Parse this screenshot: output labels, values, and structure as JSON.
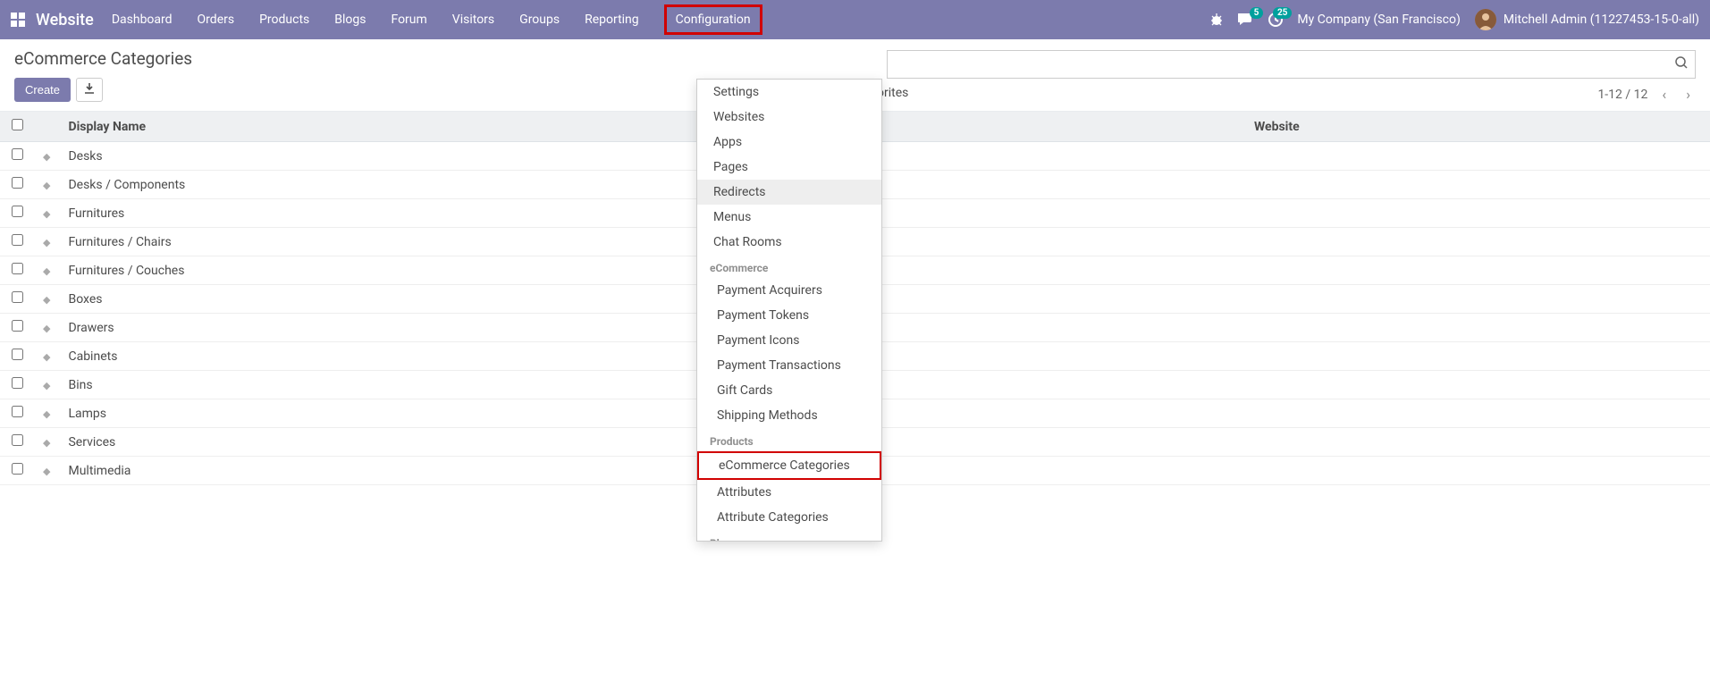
{
  "topnav": {
    "brand": "Website",
    "menu": [
      "Dashboard",
      "Orders",
      "Products",
      "Blogs",
      "Forum",
      "Visitors",
      "Groups",
      "Reporting",
      "Configuration"
    ],
    "active_index": 8,
    "messages_count": "5",
    "activities_count": "25",
    "company": "My Company (San Francisco)",
    "user": "Mitchell Admin (11227453-15-0-all)"
  },
  "page": {
    "title": "eCommerce Categories",
    "create_label": "Create",
    "filter_tail": "orites",
    "pager": "1-12 / 12",
    "columns": {
      "display_name": "Display Name",
      "website": "Website"
    },
    "rows": [
      {
        "name": "Desks"
      },
      {
        "name": "Desks / Components"
      },
      {
        "name": "Furnitures"
      },
      {
        "name": "Furnitures / Chairs"
      },
      {
        "name": "Furnitures / Couches"
      },
      {
        "name": "Boxes"
      },
      {
        "name": "Drawers"
      },
      {
        "name": "Cabinets"
      },
      {
        "name": "Bins"
      },
      {
        "name": "Lamps"
      },
      {
        "name": "Services"
      },
      {
        "name": "Multimedia"
      }
    ]
  },
  "dropdown": {
    "items": [
      {
        "type": "item",
        "label": "Settings"
      },
      {
        "type": "item",
        "label": "Websites"
      },
      {
        "type": "item",
        "label": "Apps"
      },
      {
        "type": "item",
        "label": "Pages"
      },
      {
        "type": "item",
        "label": "Redirects",
        "hover": true
      },
      {
        "type": "item",
        "label": "Menus"
      },
      {
        "type": "item",
        "label": "Chat Rooms"
      },
      {
        "type": "section",
        "label": "eCommerce"
      },
      {
        "type": "item",
        "label": "Payment Acquirers",
        "indent": true
      },
      {
        "type": "item",
        "label": "Payment Tokens",
        "indent": true
      },
      {
        "type": "item",
        "label": "Payment Icons",
        "indent": true
      },
      {
        "type": "item",
        "label": "Payment Transactions",
        "indent": true
      },
      {
        "type": "item",
        "label": "Gift Cards",
        "indent": true
      },
      {
        "type": "item",
        "label": "Shipping Methods",
        "indent": true
      },
      {
        "type": "section",
        "label": "Products"
      },
      {
        "type": "item",
        "label": "eCommerce Categories",
        "indent": true,
        "highlight": true
      },
      {
        "type": "item",
        "label": "Attributes",
        "indent": true
      },
      {
        "type": "item",
        "label": "Attribute Categories",
        "indent": true
      },
      {
        "type": "section",
        "label": "Blogs"
      }
    ]
  }
}
